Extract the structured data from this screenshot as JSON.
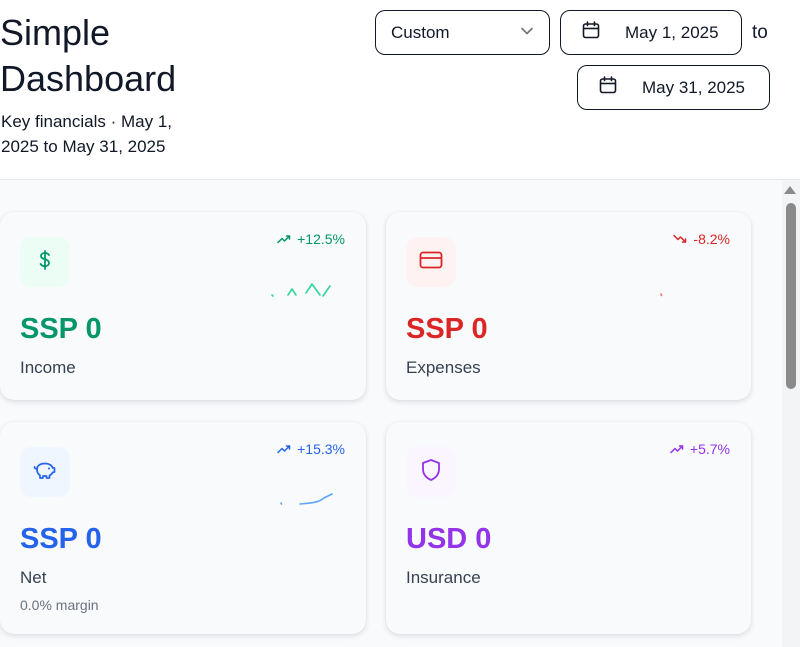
{
  "header": {
    "title": "Simple Dashboard",
    "subtitle": "Key financials · May 1, 2025 to May 31, 2025",
    "range_select": {
      "value": "Custom"
    },
    "start_date": "May 1, 2025",
    "to_label": "to",
    "end_date": "May 31, 2025"
  },
  "cards": [
    {
      "value": "SSP 0",
      "label": "Income",
      "trend": "+12.5%",
      "trend_direction": "up",
      "icon": "dollar-icon",
      "accent": "#059669",
      "icon_bg": "#ecfdf5"
    },
    {
      "value": "SSP 0",
      "label": "Expenses",
      "trend": "-8.2%",
      "trend_direction": "down",
      "icon": "credit-card-icon",
      "accent": "#dc2626",
      "icon_bg": "#fef2f2"
    },
    {
      "value": "SSP 0",
      "label": "Net",
      "sub": "0.0% margin",
      "trend": "+15.3%",
      "trend_direction": "up",
      "icon": "piggy-bank-icon",
      "accent": "#2563eb",
      "icon_bg": "#eff6ff"
    },
    {
      "value": "USD 0",
      "label": "Insurance",
      "trend": "+5.7%",
      "trend_direction": "up",
      "icon": "shield-icon",
      "accent": "#9333ea",
      "icon_bg": "#faf5ff"
    }
  ]
}
